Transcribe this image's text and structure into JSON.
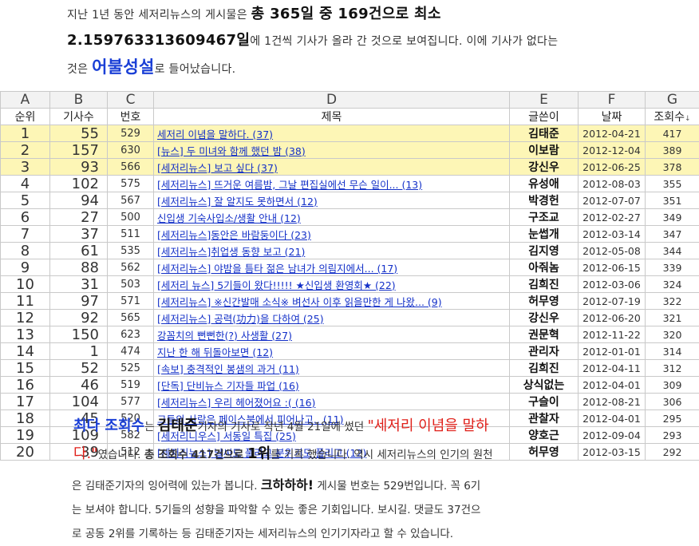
{
  "intro": {
    "t1": "지난 1년 동안 세저리뉴스의 게시물은 ",
    "b1": "총 365일 중 169건으로 최소",
    "b2": "2.159763313609467일",
    "t2": "에 1건씩 기사가 올라 간 것으로 보여집니다. 이에 기사가 없다는",
    "t3": "것은 ",
    "blue": "어불성설",
    "t4": "로 들어났습니다."
  },
  "columns": [
    "A",
    "B",
    "C",
    "D",
    "E",
    "F",
    "G"
  ],
  "headers": [
    "순위",
    "기사수",
    "번호",
    "제목",
    "글쓴이",
    "날짜",
    "조회수"
  ],
  "sort_arrow": "↓",
  "rows": [
    {
      "rank": "1",
      "count": "55",
      "no": "529",
      "title": "세저리 이념을 말하다. (37)",
      "writer": "김태준",
      "date": "2012-04-21",
      "views": "417"
    },
    {
      "rank": "2",
      "count": "157",
      "no": "630",
      "title": "[뉴스] 두 미녀와 함께 했던 밤 (38)",
      "writer": "이보람",
      "date": "2012-12-04",
      "views": "389"
    },
    {
      "rank": "3",
      "count": "93",
      "no": "566",
      "title": "[세저리뉴스] 보고 싶다 (37)",
      "writer": "강신우",
      "date": "2012-06-25",
      "views": "378"
    },
    {
      "rank": "4",
      "count": "102",
      "no": "575",
      "title": "[세저리뉴스] 뜨거운 여름밤, 그날 편집실에선 무슨 일이... (13)",
      "writer": "유성애",
      "date": "2012-08-03",
      "views": "355"
    },
    {
      "rank": "5",
      "count": "94",
      "no": "567",
      "title": "[세저리뉴스] 잘 알지도 못하면서 (12)",
      "writer": "박경헌",
      "date": "2012-07-07",
      "views": "351"
    },
    {
      "rank": "6",
      "count": "27",
      "no": "500",
      "title": "신입생 기숙사입소/생활 안내 (12)",
      "writer": "구조교",
      "date": "2012-02-27",
      "views": "349"
    },
    {
      "rank": "7",
      "count": "37",
      "no": "511",
      "title": "[세저리뉴스]동안은 바람둥이다 (23)",
      "writer": "눈썹개",
      "date": "2012-03-14",
      "views": "347"
    },
    {
      "rank": "8",
      "count": "61",
      "no": "535",
      "title": "[세저리뉴스]취업생 동향 보고 (21)",
      "writer": "김지영",
      "date": "2012-05-08",
      "views": "344"
    },
    {
      "rank": "9",
      "count": "88",
      "no": "562",
      "title": "[세저리뉴스] 야밤을 틈타 젊은 남녀가 의림지에서... (17)",
      "writer": "아줘놈",
      "date": "2012-06-15",
      "views": "339"
    },
    {
      "rank": "10",
      "count": "31",
      "no": "503",
      "title": "[세저리 뉴스] 5기들이 왔다!!!!! ★신입생 환영회★ (22)",
      "writer": "김희진",
      "date": "2012-03-06",
      "views": "324"
    },
    {
      "rank": "11",
      "count": "97",
      "no": "571",
      "title": "[세저리뉴스] ※신간발매 소식※ 벼선사 이후 읽을만한 게 나왔... (9)",
      "writer": "허무영",
      "date": "2012-07-19",
      "views": "322"
    },
    {
      "rank": "12",
      "count": "92",
      "no": "565",
      "title": "[세저리뉴스] 공력(功力)을 다하여 (25)",
      "writer": "강신우",
      "date": "2012-06-20",
      "views": "321"
    },
    {
      "rank": "13",
      "count": "150",
      "no": "623",
      "title": "강꼼치의 뻔뻔한(?) 사생활 (27)",
      "writer": "권문혁",
      "date": "2012-11-22",
      "views": "320"
    },
    {
      "rank": "14",
      "count": "1",
      "no": "474",
      "title": "지난 한 해 뒤돌아보면 (12)",
      "writer": "관리자",
      "date": "2012-01-01",
      "views": "314"
    },
    {
      "rank": "15",
      "count": "52",
      "no": "525",
      "title": "[속보] 충격적인 봉샘의 과거 (11)",
      "writer": "김희진",
      "date": "2012-04-11",
      "views": "312"
    },
    {
      "rank": "16",
      "count": "46",
      "no": "519",
      "title": "[단독] 단비뉴스 기자들 파업 (16)",
      "writer": "상식없는",
      "date": "2012-04-01",
      "views": "309"
    },
    {
      "rank": "17",
      "count": "104",
      "no": "577",
      "title": "[세저리뉴스] 우리 헤어졌어요 :( (16)",
      "writer": "구슬이",
      "date": "2012-08-21",
      "views": "306"
    },
    {
      "rank": "18",
      "count": "45",
      "no": "520",
      "title": "그들의 사랑은 페이스북에서 피어나고.. (11)",
      "writer": "관찰자",
      "date": "2012-04-01",
      "views": "295"
    },
    {
      "rank": "19",
      "count": "109",
      "no": "582",
      "title": "[세저리니우스] 서동일 특집 (25)",
      "writer": "양호근",
      "date": "2012-09-04",
      "views": "293"
    },
    {
      "rank": "20",
      "count": "39",
      "no": "512",
      "title": "[세저리뉴스] 날씨도 풀리고 분위기도 풀리고 (12)",
      "writer": "허무영",
      "date": "2012-03-15",
      "views": "292"
    }
  ],
  "summary": {
    "b1": "최다 조회수",
    "t1": "는 ",
    "b2": "김태준",
    "t2": "기자의 기사로 작년 4월 21일에 썼던 ",
    "red1": "\"세저리 이념을 말하",
    "red2": "다.\"",
    "t3": "였습니다. ",
    "b3": "총 조회수 417건으로 ",
    "b4": "1위",
    "t4": "를 기록 했습니다. 역시 세저리뉴스의 인기의 원천",
    "t5": "은 김태준기자의 잉어력에 있는가 봅니다. ",
    "b5": "크하하하!",
    "t6": " 게시물 번호는 529번입니다. 꼭 6기",
    "t7": "는 보셔야 합니다. 5기들의 성향을 파악할 수 있는 좋은 기회입니다. 보시길. 댓글도 37건으",
    "t8": "로 공동 2위를 기록하는 등 김태준기자는 세저리뉴스의 인기기자라고 할 수 있습니다."
  }
}
